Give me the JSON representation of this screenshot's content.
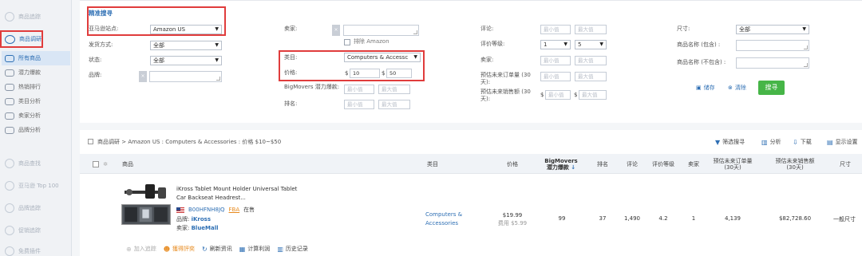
{
  "sidebar": {
    "items": [
      {
        "label": "商品追踪",
        "state": "faded"
      },
      {
        "label": "商品调研",
        "state": "active"
      },
      {
        "label": "所有商品",
        "state": "selected"
      },
      {
        "label": "潜力爆款",
        "state": "normal"
      },
      {
        "label": "热销排行",
        "state": "normal"
      },
      {
        "label": "类目分析",
        "state": "normal"
      },
      {
        "label": "卖家分析",
        "state": "normal"
      },
      {
        "label": "品牌分析",
        "state": "normal"
      },
      {
        "label": "商品查找",
        "state": "faded"
      },
      {
        "label": "亚马逊 Top 100",
        "state": "faded"
      },
      {
        "label": "品牌追踪",
        "state": "faded"
      },
      {
        "label": "促销追踪",
        "state": "faded"
      },
      {
        "label": "免费插件",
        "state": "faded"
      }
    ]
  },
  "filters": {
    "title": "精准搜寻",
    "site_label": "亚马逊站点:",
    "site_value": "Amazon US",
    "ship_label": "发货方式:",
    "ship_value": "全部",
    "status_label": "状态:",
    "status_value": "全部",
    "brand_label": "品牌:",
    "seller_label": "卖家:",
    "exclude_amazon": "排除 Amazon",
    "category_label": "类目:",
    "category_value": "Computers & Accessc",
    "price_label": "价格:",
    "price_currency": "$",
    "price_min": "10",
    "price_max": "50",
    "bigmovers_label": "BigMovers 潜力爆款:",
    "rank_label": "排名:",
    "reviews_label": "评论:",
    "rating_label": "评价等级:",
    "rating_min": "1",
    "rating_max": "5",
    "sellers_label": "卖家:",
    "orders_label": "预估未来订单量 (30 天):",
    "sales_label": "预估未来销售额 (30 天):",
    "size_label": "尺寸:",
    "size_value": "全部",
    "name_inc_label": "商品名称 (包含) :",
    "name_exc_label": "商品名称 (不包含) :",
    "ph_min": "最小值",
    "ph_max": "最大值",
    "save_label": "储存",
    "clear_label": "清除",
    "search_label": "搜寻",
    "tag_x": "×"
  },
  "results": {
    "breadcrumb": "商品调研 > Amazon US : Computers & Accessories : 价格 $10~$50",
    "tools": [
      "筛选搜寻",
      "分析",
      "下载",
      "显示设置"
    ],
    "headers": {
      "product": "商品",
      "category": "类目",
      "price": "价格",
      "bigmovers_1": "BigMovers",
      "bigmovers_2": "潜力爆款",
      "sort_arrow": "↓",
      "rank": "排名",
      "reviews": "评论",
      "rating": "评价等级",
      "sellers": "卖家",
      "orders_1": "预估未来订单量",
      "orders_2": "(30天)",
      "sales_1": "预估未来销售额",
      "sales_2": "(30天)",
      "size": "尺寸"
    },
    "row": {
      "name_line1": "iKross Tablet Mount Holder Universal Tablet",
      "name_line2": "Car Backseat Headrest...",
      "asin": "B00HFNH8JQ",
      "fba": "FBA",
      "status": "在售",
      "brand_prefix": "品牌:",
      "brand": "iKross",
      "seller_prefix": "卖家:",
      "seller": "BlueMall",
      "category_1": "Computers &",
      "category_2": "Accessories",
      "price": "$19.99",
      "fee": "费用 $5.99",
      "bigmovers": "99",
      "rank": "37",
      "reviews": "1,490",
      "rating": "4.2",
      "sellers": "1",
      "orders": "4,139",
      "sales": "$82,728.60",
      "size": "一般尺寸"
    },
    "actions": [
      "加入追踪",
      "獲得評奕",
      "刷新资讯",
      "计算利润",
      "历史记录"
    ]
  }
}
